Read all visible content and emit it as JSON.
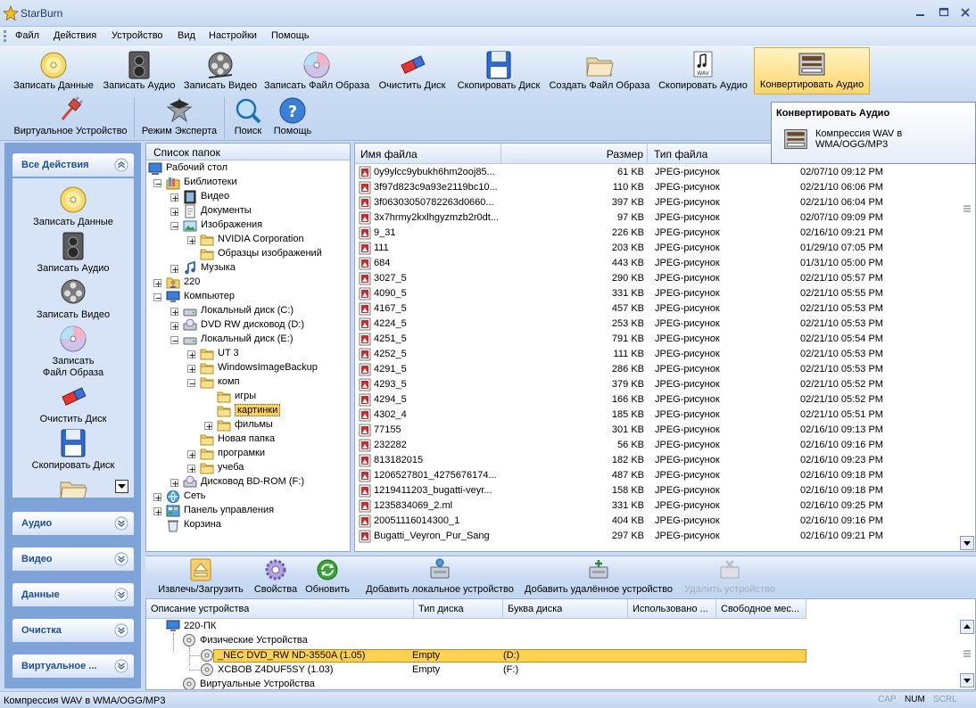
{
  "window": {
    "title": "StarBurn"
  },
  "menu": [
    "Файл",
    "Действия",
    "Устройство",
    "Вид",
    "Настройки",
    "Помощь"
  ],
  "toolbar": {
    "row1": [
      "Записать Данные",
      "Записать Аудио",
      "Записать Видео",
      "Записать Файл Образа",
      "Очистить Диск",
      "Скопировать Диск",
      "Создать Файл Образа",
      "Скопировать Аудио",
      "Конвертировать Аудио"
    ],
    "row2": [
      "Виртуальное Устройство",
      "Режим Эксперта",
      "Поиск",
      "Помощь"
    ]
  },
  "tooltip": {
    "title": "Конвертировать Аудио",
    "text": "Компрессия WAV в WMA/OGG/MP3"
  },
  "left_panel": {
    "all_actions": "Все Действия",
    "items": [
      "Записать Данные",
      "Записать Аудио",
      "Записать Видео",
      "Записать Файл Образа",
      "Очистить Диск",
      "Скопировать Диск"
    ],
    "sections": [
      "Аудио",
      "Видео",
      "Данные",
      "Очистка",
      "Виртуальное ..."
    ]
  },
  "folder_tree": {
    "title": "Список папок",
    "nodes": [
      {
        "label": "Рабочий стол",
        "level": 0,
        "exp": "",
        "icon": "desktop"
      },
      {
        "label": "Библиотеки",
        "level": 1,
        "exp": "-",
        "icon": "library"
      },
      {
        "label": "Видео",
        "level": 2,
        "exp": "+",
        "icon": "video"
      },
      {
        "label": "Документы",
        "level": 2,
        "exp": "+",
        "icon": "docs"
      },
      {
        "label": "Изображения",
        "level": 2,
        "exp": "-",
        "icon": "images"
      },
      {
        "label": "NVIDIA Corporation",
        "level": 3,
        "exp": "+",
        "icon": "folder"
      },
      {
        "label": "Образцы изображений",
        "level": 3,
        "exp": "",
        "icon": "folder"
      },
      {
        "label": "Музыка",
        "level": 2,
        "exp": "+",
        "icon": "music"
      },
      {
        "label": "220",
        "level": 1,
        "exp": "+",
        "icon": "user"
      },
      {
        "label": "Компьютер",
        "level": 1,
        "exp": "-",
        "icon": "computer"
      },
      {
        "label": "Локальный диск  (C:)",
        "level": 2,
        "exp": "+",
        "icon": "drive"
      },
      {
        "label": "DVD RW дисковод (D:)",
        "level": 2,
        "exp": "+",
        "icon": "dvd"
      },
      {
        "label": "Локальный диск  (E:)",
        "level": 2,
        "exp": "-",
        "icon": "drive"
      },
      {
        "label": "UT 3",
        "level": 3,
        "exp": "+",
        "icon": "folder"
      },
      {
        "label": "WindowsImageBackup",
        "level": 3,
        "exp": "+",
        "icon": "folder"
      },
      {
        "label": "комп",
        "level": 3,
        "exp": "-",
        "icon": "folder"
      },
      {
        "label": "игры",
        "level": 4,
        "exp": "",
        "icon": "folder"
      },
      {
        "label": "картинки",
        "level": 4,
        "exp": "",
        "icon": "folder",
        "selected": true
      },
      {
        "label": "фильмы",
        "level": 4,
        "exp": "+",
        "icon": "folder"
      },
      {
        "label": "Новая папка",
        "level": 3,
        "exp": "",
        "icon": "folder"
      },
      {
        "label": "програмки",
        "level": 3,
        "exp": "+",
        "icon": "folder"
      },
      {
        "label": "учеба",
        "level": 3,
        "exp": "+",
        "icon": "folder"
      },
      {
        "label": "Дисковод BD-ROM (F:)",
        "level": 2,
        "exp": "+",
        "icon": "dvd"
      },
      {
        "label": "Сеть",
        "level": 1,
        "exp": "+",
        "icon": "network"
      },
      {
        "label": "Панель управления",
        "level": 1,
        "exp": "+",
        "icon": "control"
      },
      {
        "label": "Корзина",
        "level": 1,
        "exp": "",
        "icon": "recycle"
      }
    ]
  },
  "file_list": {
    "columns": [
      "Имя файла",
      "Размер",
      "Тип файла"
    ],
    "rows": [
      [
        "0y9ylcc9ybukh6hm2ooj85...",
        "61 KB",
        "JPEG-рисунок",
        "02/07/10 09:12 PM"
      ],
      [
        "3f97d823c9a93e2119bc10...",
        "110 KB",
        "JPEG-рисунок",
        "02/21/10 06:06 PM"
      ],
      [
        "3f06303050782263d0660...",
        "397 KB",
        "JPEG-рисунок",
        "02/21/10 06:04 PM"
      ],
      [
        "3x7hrmy2kxlhgyzmzb2r0dt...",
        "97 KB",
        "JPEG-рисунок",
        "02/07/10 09:09 PM"
      ],
      [
        "9_31",
        "226 KB",
        "JPEG-рисунок",
        "02/16/10 09:21 PM"
      ],
      [
        "111",
        "203 KB",
        "JPEG-рисунок",
        "01/29/10 07:05 PM"
      ],
      [
        "684",
        "443 KB",
        "JPEG-рисунок",
        "01/31/10 05:00 PM"
      ],
      [
        "3027_5",
        "290 KB",
        "JPEG-рисунок",
        "02/21/10 05:57 PM"
      ],
      [
        "4090_5",
        "331 KB",
        "JPEG-рисунок",
        "02/21/10 05:55 PM"
      ],
      [
        "4167_5",
        "457 KB",
        "JPEG-рисунок",
        "02/21/10 05:53 PM"
      ],
      [
        "4224_5",
        "253 KB",
        "JPEG-рисунок",
        "02/21/10 05:53 PM"
      ],
      [
        "4251_5",
        "791 KB",
        "JPEG-рисунок",
        "02/21/10 05:54 PM"
      ],
      [
        "4252_5",
        "111 KB",
        "JPEG-рисунок",
        "02/21/10 05:53 PM"
      ],
      [
        "4291_5",
        "286 KB",
        "JPEG-рисунок",
        "02/21/10 05:53 PM"
      ],
      [
        "4293_5",
        "379 KB",
        "JPEG-рисунок",
        "02/21/10 05:52 PM"
      ],
      [
        "4294_5",
        "166 KB",
        "JPEG-рисунок",
        "02/21/10 05:52 PM"
      ],
      [
        "4302_4",
        "185 KB",
        "JPEG-рисунок",
        "02/21/10 05:51 PM"
      ],
      [
        "77155",
        "301 KB",
        "JPEG-рисунок",
        "02/16/10 09:13 PM"
      ],
      [
        "232282",
        "56 KB",
        "JPEG-рисунок",
        "02/16/10 09:16 PM"
      ],
      [
        "813182015",
        "182 KB",
        "JPEG-рисунок",
        "02/16/10 09:23 PM"
      ],
      [
        "1206527801_4275676174...",
        "487 KB",
        "JPEG-рисунок",
        "02/16/10 09:18 PM"
      ],
      [
        "1219411203_bugatti-veyr...",
        "158 KB",
        "JPEG-рисунок",
        "02/16/10 09:18 PM"
      ],
      [
        "1235834069_2.ml",
        "331 KB",
        "JPEG-рисунок",
        "02/16/10 09:25 PM"
      ],
      [
        "20051116014300_1",
        "404 KB",
        "JPEG-рисунок",
        "02/16/10 09:16 PM"
      ],
      [
        "Bugatti_Veyron_Pur_Sang",
        "297 KB",
        "JPEG-рисунок",
        "02/16/10 09:21 PM"
      ]
    ]
  },
  "device_toolbar": [
    "Извлечь/Загрузить",
    "Свойства",
    "Обновить",
    "Добавить локальное устройство",
    "Добавить удалённое устройство",
    "Удалить устройство"
  ],
  "device_list": {
    "columns": [
      "Описание устройства",
      "Тип диска",
      "Буква диска",
      "Использовано ...",
      "Свободное мес..."
    ],
    "root": "220-ПК",
    "physical": "Физические Устройства",
    "devices": [
      {
        "name": "_NEC     DVD_RW ND-3550A   (1.05)",
        "type": "Empty",
        "letter": "(D:)"
      },
      {
        "name": "XCBOB    Z4DUF5SY        (1.03)",
        "type": "Empty",
        "letter": "(F:)"
      }
    ],
    "virtual": "Виртуальные Устройства"
  },
  "status": {
    "text": "Компрессия WAV в WMA/OGG/MP3",
    "indicators": [
      "CAP",
      "NUM",
      "SCRL"
    ]
  }
}
